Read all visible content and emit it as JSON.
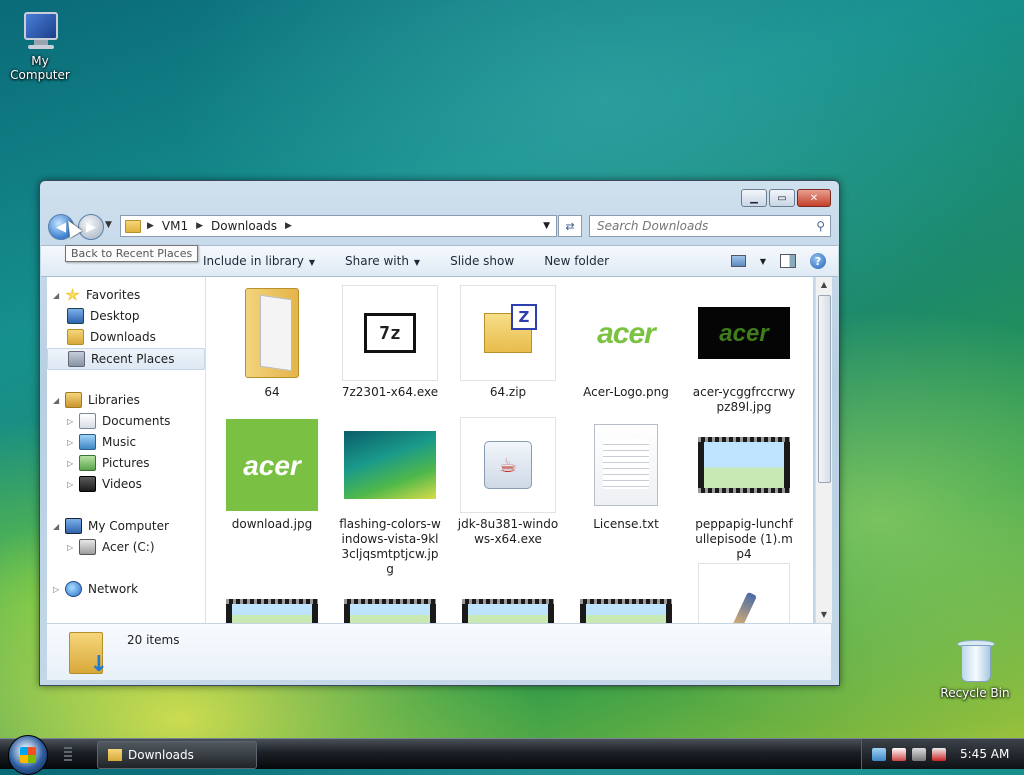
{
  "desktop": {
    "icons": [
      {
        "label": "My Computer",
        "icon": "computer-icon"
      },
      {
        "label": "Recycle Bin",
        "icon": "recycle-bin-icon"
      }
    ]
  },
  "window": {
    "address": {
      "segments": [
        "VM1",
        "Downloads"
      ]
    },
    "search": {
      "placeholder": "Search Downloads"
    },
    "tooltip": "Back to Recent Places",
    "toolbar": {
      "include_in_library": "Include in library",
      "share_with": "Share with",
      "slide_show": "Slide show",
      "new_folder": "New folder"
    },
    "sidebar": {
      "favorites": {
        "label": "Favorites",
        "items": [
          "Desktop",
          "Downloads",
          "Recent Places"
        ]
      },
      "libraries": {
        "label": "Libraries",
        "items": [
          "Documents",
          "Music",
          "Pictures",
          "Videos"
        ]
      },
      "computer": {
        "label": "My Computer",
        "items": [
          "Acer (C:)"
        ]
      },
      "network": {
        "label": "Network"
      }
    },
    "files": [
      {
        "name": "64",
        "type": "folder"
      },
      {
        "name": "7z2301-x64.exe",
        "type": "exe"
      },
      {
        "name": "64.zip",
        "type": "zip"
      },
      {
        "name": "Acer-Logo.png",
        "type": "image"
      },
      {
        "name": "acer-ycggfrccrwypz89l.jpg",
        "type": "image"
      },
      {
        "name": "download.jpg",
        "type": "image"
      },
      {
        "name": "flashing-colors-windows-vista-9kl3cljqsmtptjcw.jpg",
        "type": "image"
      },
      {
        "name": "jdk-8u381-windows-x64.exe",
        "type": "exe"
      },
      {
        "name": "License.txt",
        "type": "text"
      },
      {
        "name": "peppapig-lunchfullepisode (1).mp4",
        "type": "video"
      }
    ],
    "status": {
      "count": "20 items"
    }
  },
  "taskbar": {
    "task_label": "Downloads",
    "clock": "5:45 AM"
  }
}
